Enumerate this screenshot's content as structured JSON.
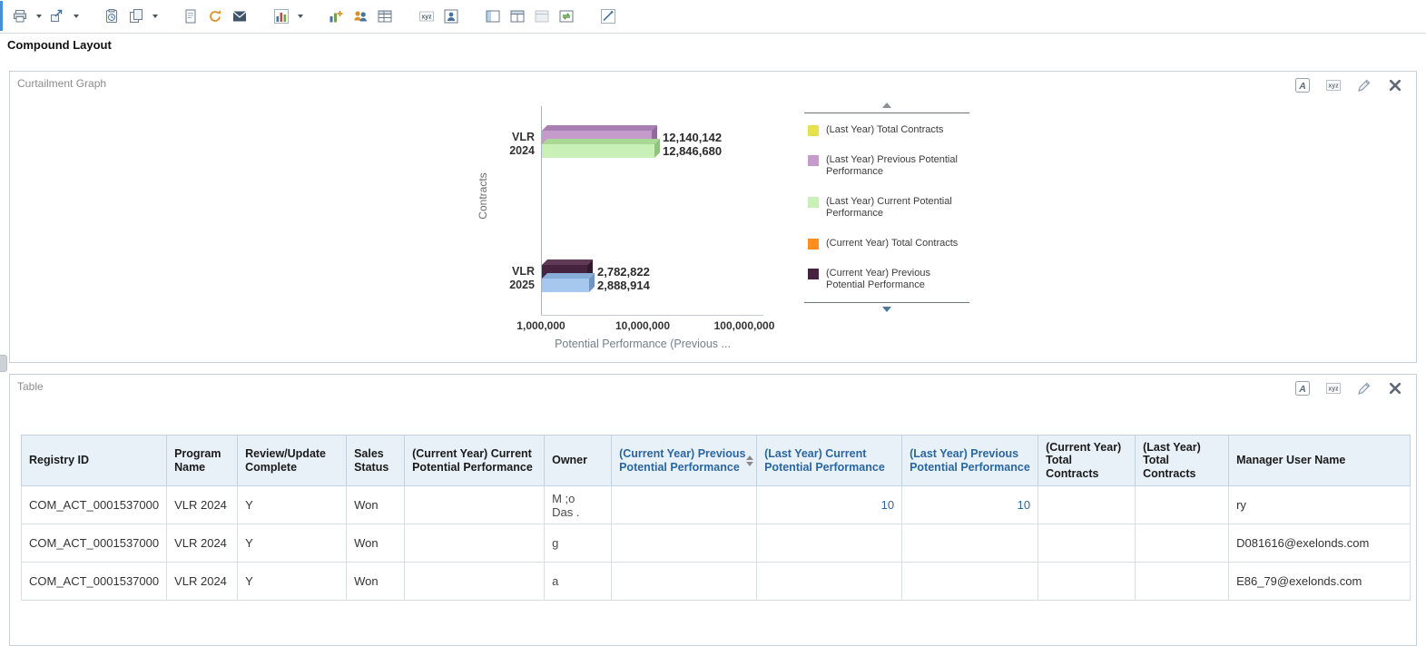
{
  "page": {
    "title": "Compound Layout"
  },
  "toolbar": {
    "groups": [
      {
        "icons": [
          {
            "name": "print",
            "caret": true
          },
          {
            "name": "export",
            "caret": true
          }
        ]
      },
      {
        "icons": [
          {
            "name": "schedule",
            "caret": false
          },
          {
            "name": "copy",
            "caret": true
          }
        ]
      },
      {
        "icons": [
          {
            "name": "print-preview",
            "caret": false
          },
          {
            "name": "refresh",
            "caret": false
          },
          {
            "name": "email",
            "caret": false
          }
        ]
      },
      {
        "icons": [
          {
            "name": "new-view",
            "caret": true
          }
        ]
      },
      {
        "icons": [
          {
            "name": "new-calculated-measure",
            "caret": false
          },
          {
            "name": "new-group",
            "caret": false
          },
          {
            "name": "new-calculated-item",
            "caret": false
          }
        ]
      },
      {
        "icons": [
          {
            "name": "rename",
            "caret": false
          },
          {
            "name": "view-properties",
            "caret": false
          }
        ]
      },
      {
        "icons": [
          {
            "name": "show-filters-pane",
            "caret": false
          },
          {
            "name": "duplicate-layout",
            "caret": false
          },
          {
            "name": "layout-disabled",
            "caret": false
          },
          {
            "name": "swap-panes",
            "caret": false
          }
        ]
      },
      {
        "icons": [
          {
            "name": "edit-chart",
            "caret": false
          }
        ]
      }
    ]
  },
  "graph_panel": {
    "title": "Curtailment Graph",
    "header_icons": [
      "format-container",
      "view-properties-xyz",
      "edit-view",
      "remove-view"
    ]
  },
  "chart_data": {
    "type": "bar",
    "orientation": "horizontal",
    "x_scale": "log",
    "title": "",
    "xlabel": "Potential Performance (Previous ...",
    "ylabel": "Contracts",
    "x_ticks": [
      "1,000,000",
      "10,000,000",
      "100,000,000"
    ],
    "x_tick_values": [
      1000000,
      10000000,
      100000000
    ],
    "categories": [
      "VLR 2024",
      "VLR 2025"
    ],
    "bars": [
      {
        "category": "VLR 2024",
        "series": "(Last Year) Previous Potential Performance",
        "value": 12140142,
        "label": "12,140,142",
        "color": "#c49bcb",
        "color_top": "#a87fb2",
        "color_side": "#93689d"
      },
      {
        "category": "VLR 2024",
        "series": "(Last Year) Current Potential Performance",
        "value": 12846680,
        "label": "12,846,680",
        "color": "#c9f0b6",
        "color_top": "#a8d894",
        "color_side": "#8fc47c"
      },
      {
        "category": "VLR 2025",
        "series": "(Current Year) Previous Potential Performance",
        "value": 2782822,
        "label": "2,782,822",
        "color": "#46243f",
        "color_top": "#5e3a56",
        "color_side": "#331a2e"
      },
      {
        "category": "VLR 2025",
        "series": "(Current Year) Current Potential Performance",
        "value": 2888914,
        "label": "2,888,914",
        "color": "#a6c8ee",
        "color_top": "#87add9",
        "color_side": "#7095c2"
      }
    ],
    "legend": [
      {
        "label": "(Last Year) Total Contracts",
        "color": "#e6e14f"
      },
      {
        "label": "(Last Year) Previous Potential Performance",
        "color": "#c49bcb"
      },
      {
        "label": "(Last Year) Current Potential Performance",
        "color": "#c9f0b6"
      },
      {
        "label": "(Current Year) Total Contracts",
        "color": "#ff8d1e"
      },
      {
        "label": "(Current Year) Previous Potential Performance",
        "color": "#46243f"
      }
    ],
    "legend_scrollable": true
  },
  "table_panel": {
    "title": "Table",
    "header_icons": [
      "format-container",
      "view-properties-xyz",
      "edit-view",
      "remove-view"
    ],
    "link_color": "#2a66a0",
    "header_bg": "#e9f1f8",
    "columns": [
      {
        "label": "Registry ID",
        "link": false
      },
      {
        "label": "Program Name",
        "link": false
      },
      {
        "label": "Review/Update Complete",
        "link": false
      },
      {
        "label": "Sales Status",
        "link": false
      },
      {
        "label": "(Current Year) Current Potential Performance",
        "link": false
      },
      {
        "label": "Owner",
        "link": false
      },
      {
        "label": "(Current Year) Previous Potential Performance",
        "link": true,
        "sortable": true
      },
      {
        "label": "(Last Year) Current Potential Performance",
        "link": true
      },
      {
        "label": "(Last Year) Previous Potential Performance",
        "link": true
      },
      {
        "label": "(Current Year) Total Contracts",
        "link": false
      },
      {
        "label": "(Last Year) Total Contracts",
        "link": false
      },
      {
        "label": "Manager User Name",
        "link": false
      }
    ],
    "rows": [
      [
        "COM_ACT_0001537000",
        "VLR 2024",
        "Y",
        "Won",
        "",
        "M ;o\nDas .",
        "",
        "10",
        "10",
        "",
        "",
        "ry"
      ],
      [
        "COM_ACT_0001537000",
        "VLR 2024",
        "Y",
        "Won",
        "",
        "g",
        "",
        "",
        "",
        "",
        "",
        "D081616@exelonds.com"
      ],
      [
        "COM_ACT_0001537000",
        "VLR 2024",
        "Y",
        "Won",
        "",
        "a",
        "",
        "",
        "",
        "",
        "",
        "E86_79@exelonds.com"
      ]
    ]
  }
}
